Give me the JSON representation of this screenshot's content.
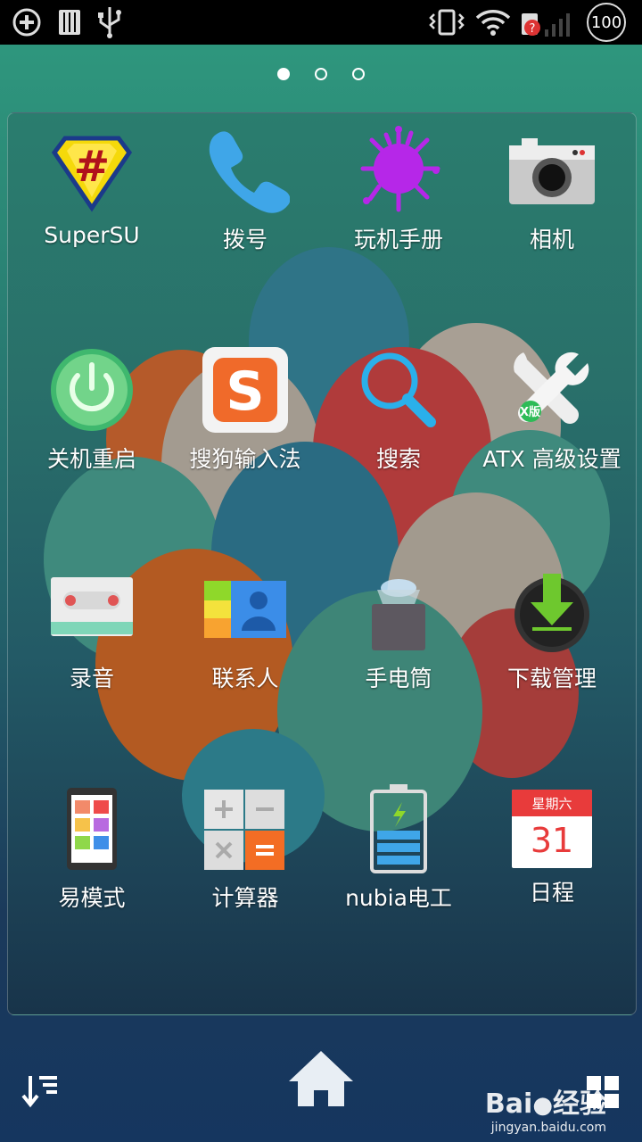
{
  "status_bar": {
    "icons": [
      "add-circle-icon",
      "sd-card-icon",
      "usb-icon",
      "vibrate-icon",
      "wifi-icon",
      "no-sim-icon",
      "signal-icon"
    ],
    "battery": "100"
  },
  "pager": {
    "pages": 3,
    "active": 0
  },
  "apps": [
    {
      "label": "SuperSU",
      "icon": "supersu-icon"
    },
    {
      "label": "拨号",
      "icon": "phone-icon"
    },
    {
      "label": "玩机手册",
      "icon": "manual-splash-icon"
    },
    {
      "label": "相机",
      "icon": "camera-icon"
    },
    {
      "label": "关机重启",
      "icon": "power-icon"
    },
    {
      "label": "搜狗输入法",
      "icon": "sogou-icon"
    },
    {
      "label": "搜索",
      "icon": "search-icon"
    },
    {
      "label": "ATX 高级设置",
      "icon": "wrench-icon",
      "badge": "X版"
    },
    {
      "label": "录音",
      "icon": "recorder-icon"
    },
    {
      "label": "联系人",
      "icon": "contacts-icon"
    },
    {
      "label": "手电筒",
      "icon": "flashlight-icon"
    },
    {
      "label": "下载管理",
      "icon": "download-icon"
    },
    {
      "label": "易模式",
      "icon": "easy-mode-icon"
    },
    {
      "label": "计算器",
      "icon": "calculator-icon"
    },
    {
      "label": "nubia电工",
      "icon": "battery-app-icon"
    },
    {
      "label": "日程",
      "icon": "calendar-icon",
      "calendar_day": "星期六",
      "calendar_date": "31"
    }
  ],
  "dock": {
    "left": "sort-icon",
    "center": "home-icon",
    "right": "apps-grid-icon"
  },
  "watermark": {
    "brand": "Bai",
    "brand2": "经验",
    "url": "jingyan.baidu.com"
  },
  "colors": {
    "accent_green": "#2b9a7c",
    "status_bar": "#000000"
  }
}
